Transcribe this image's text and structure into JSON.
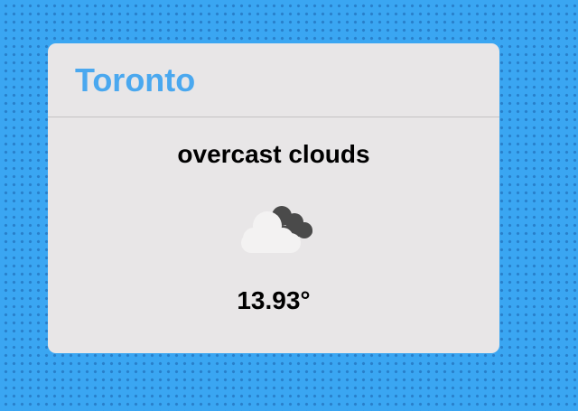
{
  "weather_card": {
    "city": "Toronto",
    "description": "overcast clouds",
    "temperature": "13.93°",
    "icon": "overcast-clouds-icon"
  },
  "colors": {
    "page_background": "#3aa6f2",
    "card_background": "#e8e6e7",
    "city_text": "#4aa8ef",
    "dark_cloud": "#4a4a4a",
    "light_cloud": "#f3f2f2"
  }
}
